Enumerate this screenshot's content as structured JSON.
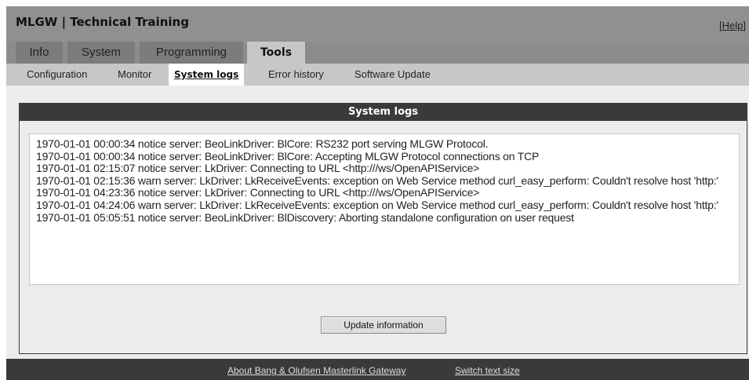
{
  "header": {
    "title": "MLGW | Technical Training",
    "help_label": "[Help]"
  },
  "main_tabs": [
    {
      "label": "Info"
    },
    {
      "label": "System"
    },
    {
      "label": "Programming"
    },
    {
      "label": "Tools",
      "active": true
    }
  ],
  "sub_tabs": [
    {
      "label": "Configuration"
    },
    {
      "label": "Monitor"
    },
    {
      "label": "System logs",
      "active": true
    },
    {
      "label": "Error history"
    },
    {
      "label": "Software Update"
    }
  ],
  "panel": {
    "title": "System logs",
    "log_lines": [
      "1970-01-01 00:00:34 notice server: BeoLinkDriver: BlCore: RS232 port serving MLGW Protocol.",
      "1970-01-01 00:00:34 notice server: BeoLinkDriver: BlCore: Accepting MLGW Protocol connections on TCP",
      "1970-01-01 02:15:07 notice server: LkDriver: Connecting to URL <http:///ws/OpenAPIService>",
      "1970-01-01 02:15:36 warn server: LkDriver: LkReceiveEvents: exception on Web Service method curl_easy_perform: Couldn't resolve host 'http:'",
      "1970-01-01 04:23:36 notice server: LkDriver: Connecting to URL <http:///ws/OpenAPIService>",
      "1970-01-01 04:24:06 warn server: LkDriver: LkReceiveEvents: exception on Web Service method curl_easy_perform: Couldn't resolve host 'http:'",
      "1970-01-01 05:05:51 notice server: BeoLinkDriver: BlDiscovery: Aborting standalone configuration on user request"
    ],
    "update_button_label": "Update information"
  },
  "footer": {
    "about_label": "About Bang & Olufsen Masterlink Gateway",
    "text_size_label": "Switch text size"
  }
}
